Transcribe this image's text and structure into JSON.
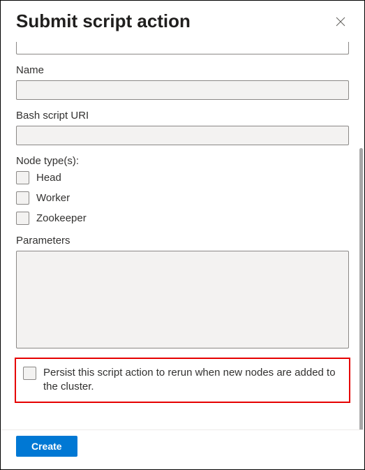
{
  "header": {
    "title": "Submit script action"
  },
  "form": {
    "name_label": "Name",
    "name_value": "",
    "bash_uri_label": "Bash script URI",
    "bash_uri_value": "",
    "node_types_label": "Node type(s):",
    "node_types": [
      {
        "label": "Head",
        "checked": false
      },
      {
        "label": "Worker",
        "checked": false
      },
      {
        "label": "Zookeeper",
        "checked": false
      }
    ],
    "parameters_label": "Parameters",
    "parameters_value": "",
    "persist_label": "Persist this script action to rerun when new nodes are added to the cluster.",
    "persist_checked": false
  },
  "footer": {
    "create_label": "Create"
  }
}
